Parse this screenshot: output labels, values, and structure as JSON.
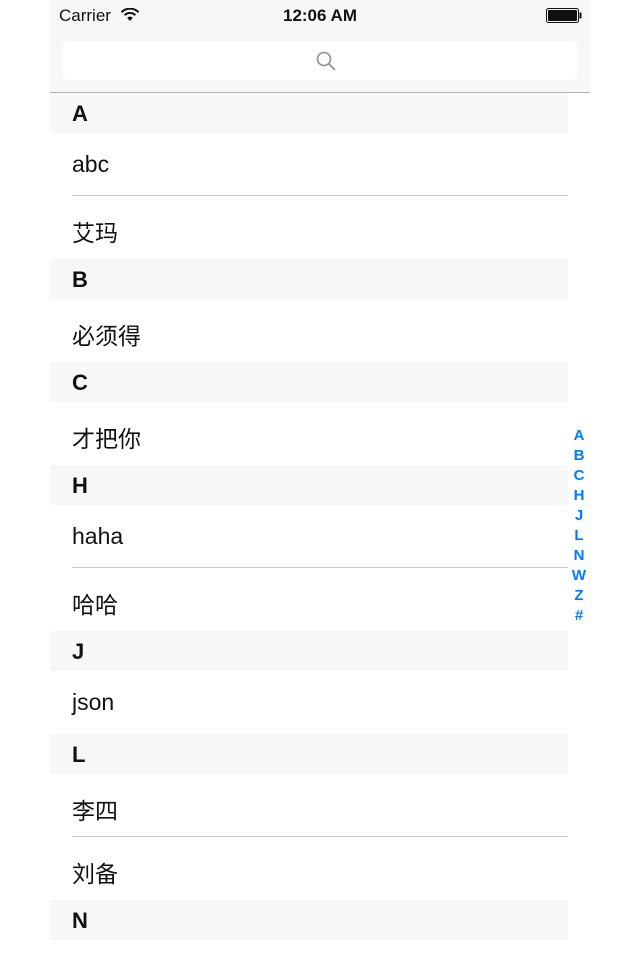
{
  "status_bar": {
    "carrier": "Carrier",
    "time": "12:06 AM"
  },
  "search": {
    "placeholder": ""
  },
  "colors": {
    "accent": "#007aff",
    "section_bg": "#f7f7f7",
    "separator": "#c8c7cc"
  },
  "sections": [
    {
      "header": "A",
      "rows": [
        "abc",
        "艾玛"
      ]
    },
    {
      "header": "B",
      "rows": [
        "必须得"
      ]
    },
    {
      "header": "C",
      "rows": [
        "才把你"
      ]
    },
    {
      "header": "H",
      "rows": [
        "haha",
        "哈哈"
      ]
    },
    {
      "header": "J",
      "rows": [
        "json"
      ]
    },
    {
      "header": "L",
      "rows": [
        "李四",
        "刘备"
      ]
    },
    {
      "header": "N",
      "rows": []
    }
  ],
  "index": [
    "A",
    "B",
    "C",
    "H",
    "J",
    "L",
    "N",
    "W",
    "Z",
    "#"
  ]
}
